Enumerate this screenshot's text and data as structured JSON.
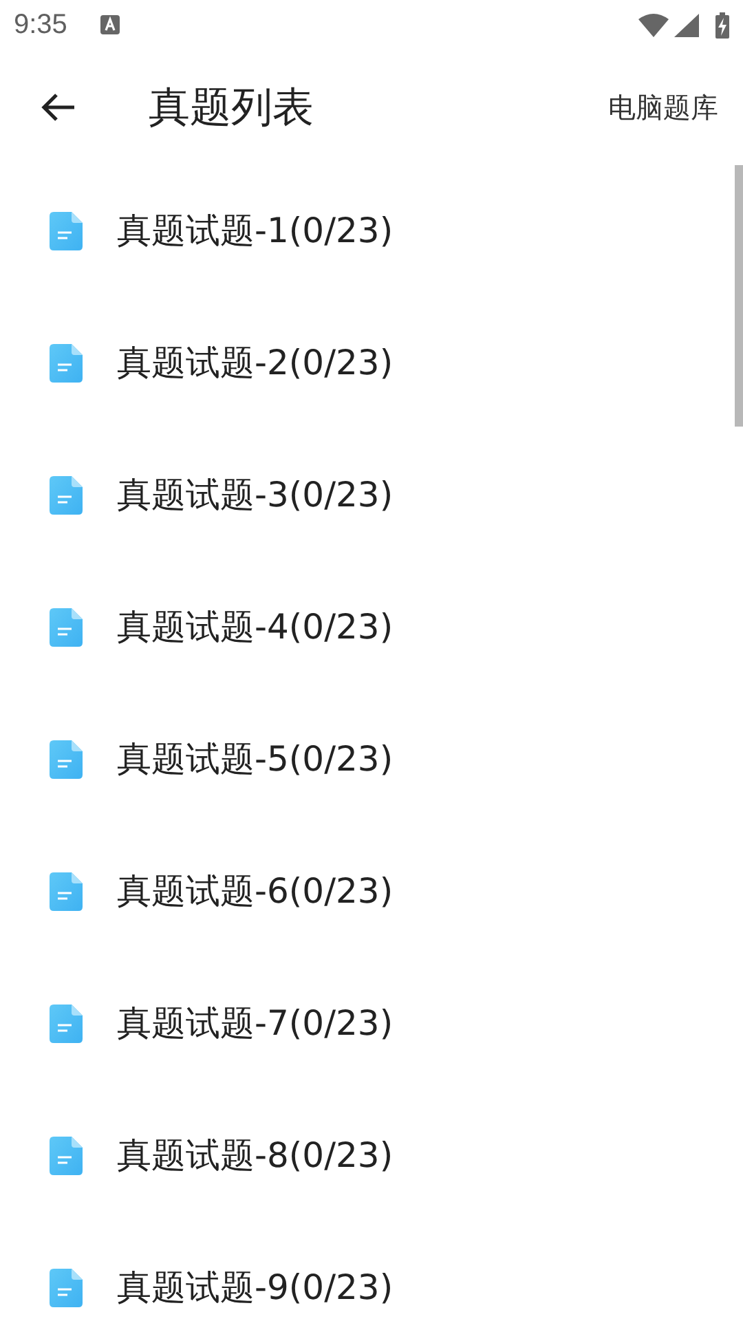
{
  "status_bar": {
    "time": "9:35"
  },
  "header": {
    "title": "真题列表",
    "action": "电脑题库"
  },
  "items": [
    {
      "label": "真题试题-1(0/23)"
    },
    {
      "label": "真题试题-2(0/23)"
    },
    {
      "label": "真题试题-3(0/23)"
    },
    {
      "label": "真题试题-4(0/23)"
    },
    {
      "label": "真题试题-5(0/23)"
    },
    {
      "label": "真题试题-6(0/23)"
    },
    {
      "label": "真题试题-7(0/23)"
    },
    {
      "label": "真题试题-8(0/23)"
    },
    {
      "label": "真题试题-9(0/23)"
    }
  ]
}
